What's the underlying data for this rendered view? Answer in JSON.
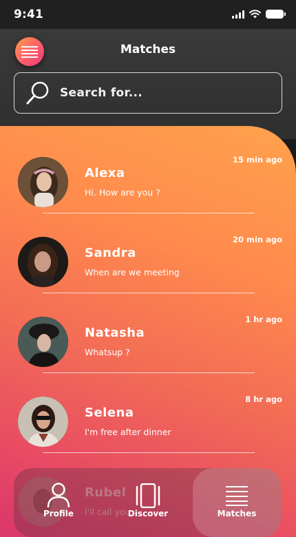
{
  "status_bar": {
    "time": "9:41"
  },
  "header": {
    "title": "Matches",
    "menu_icon": "hamburger-menu-icon"
  },
  "search": {
    "placeholder": "Search for..."
  },
  "chats": [
    {
      "name": "Alexa",
      "message": "Hi. How are you ?",
      "time": "15 min ago"
    },
    {
      "name": "Sandra",
      "message": "When are we meeting",
      "time": "20 min ago"
    },
    {
      "name": "Natasha",
      "message": "Whatsup ?",
      "time": "1 hr ago"
    },
    {
      "name": "Selena",
      "message": "I'm free after dinner",
      "time": "8 hr ago"
    },
    {
      "name": "Rubel",
      "message": "I'll call you",
      "time": ""
    }
  ],
  "bottom_nav": [
    {
      "label": "Profile",
      "icon": "person-icon"
    },
    {
      "label": "Discover",
      "icon": "cards-icon"
    },
    {
      "label": "Matches",
      "icon": "list-icon"
    }
  ],
  "colors": {
    "accent_orange": "#ffa24c",
    "accent_pink": "#d6336b",
    "header_bg": "#333333"
  }
}
